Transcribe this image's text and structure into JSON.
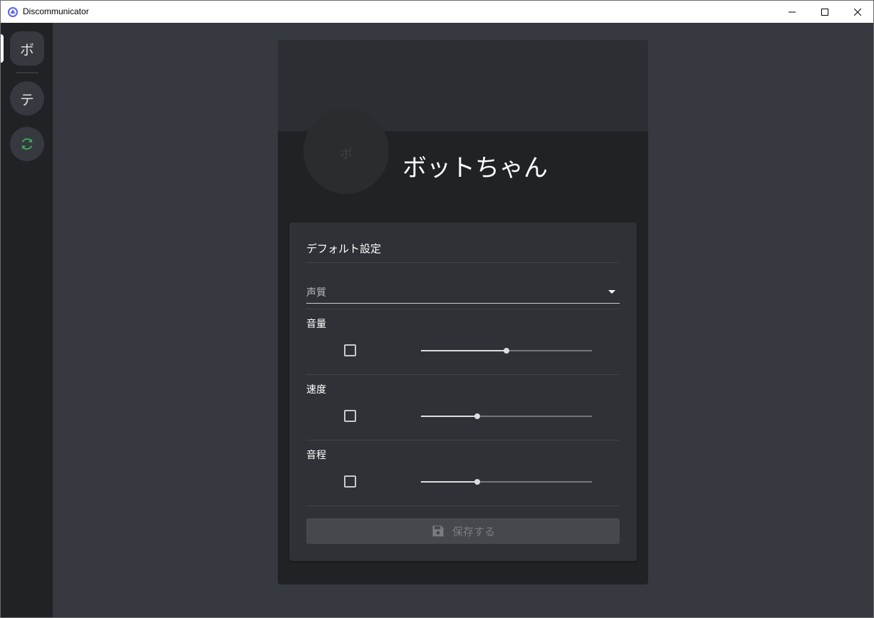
{
  "window": {
    "title": "Discommunicator"
  },
  "sidebar": {
    "items": [
      {
        "label": "ボ",
        "active": true
      },
      {
        "label": "テ",
        "active": false
      },
      {
        "icon": "refresh-icon",
        "color": "#3ba55d"
      }
    ]
  },
  "bot": {
    "avatar_text": "ボ",
    "name": "ボットちゃん"
  },
  "settings": {
    "title": "デフォルト設定",
    "voice_select": {
      "label": "声質",
      "value": ""
    },
    "sliders": [
      {
        "label": "音量",
        "checked": false,
        "value": 0.5
      },
      {
        "label": "速度",
        "checked": false,
        "value": 0.33
      },
      {
        "label": "音程",
        "checked": false,
        "value": 0.33
      }
    ],
    "save_button": {
      "label": "保存する",
      "icon": "floppy-disk-icon",
      "enabled": false
    }
  },
  "colors": {
    "background": "#36393f",
    "sidebar": "#202225",
    "panel": "#2f3136",
    "accent_green": "#3ba55d"
  }
}
